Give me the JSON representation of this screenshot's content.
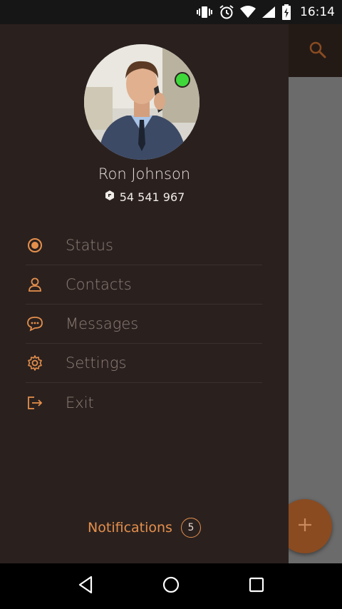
{
  "status_bar": {
    "time": "16:14",
    "icons": [
      "vibrate-icon",
      "alarm-icon",
      "wifi-icon",
      "signal-icon",
      "battery-icon"
    ]
  },
  "app": {
    "toolbar_icon": "search-icon",
    "fab_icon": "plus-icon"
  },
  "drawer": {
    "user": {
      "name": "Ron Johnson",
      "phone": "54 541 967",
      "online": true
    },
    "menu": [
      {
        "label": "Status",
        "icon": "status-radio-icon"
      },
      {
        "label": "Contacts",
        "icon": "person-icon"
      },
      {
        "label": "Messages",
        "icon": "chat-bubble-icon"
      },
      {
        "label": "Settings",
        "icon": "gear-icon"
      },
      {
        "label": "Exit",
        "icon": "exit-icon"
      }
    ],
    "notifications": {
      "label": "Notifications",
      "count": "5"
    }
  },
  "nav": {
    "back": "back-icon",
    "home": "home-icon",
    "recents": "recents-icon"
  },
  "colors": {
    "accent": "#e58f4c",
    "drawer_bg": "#2a211f",
    "online": "#3fd83a"
  }
}
